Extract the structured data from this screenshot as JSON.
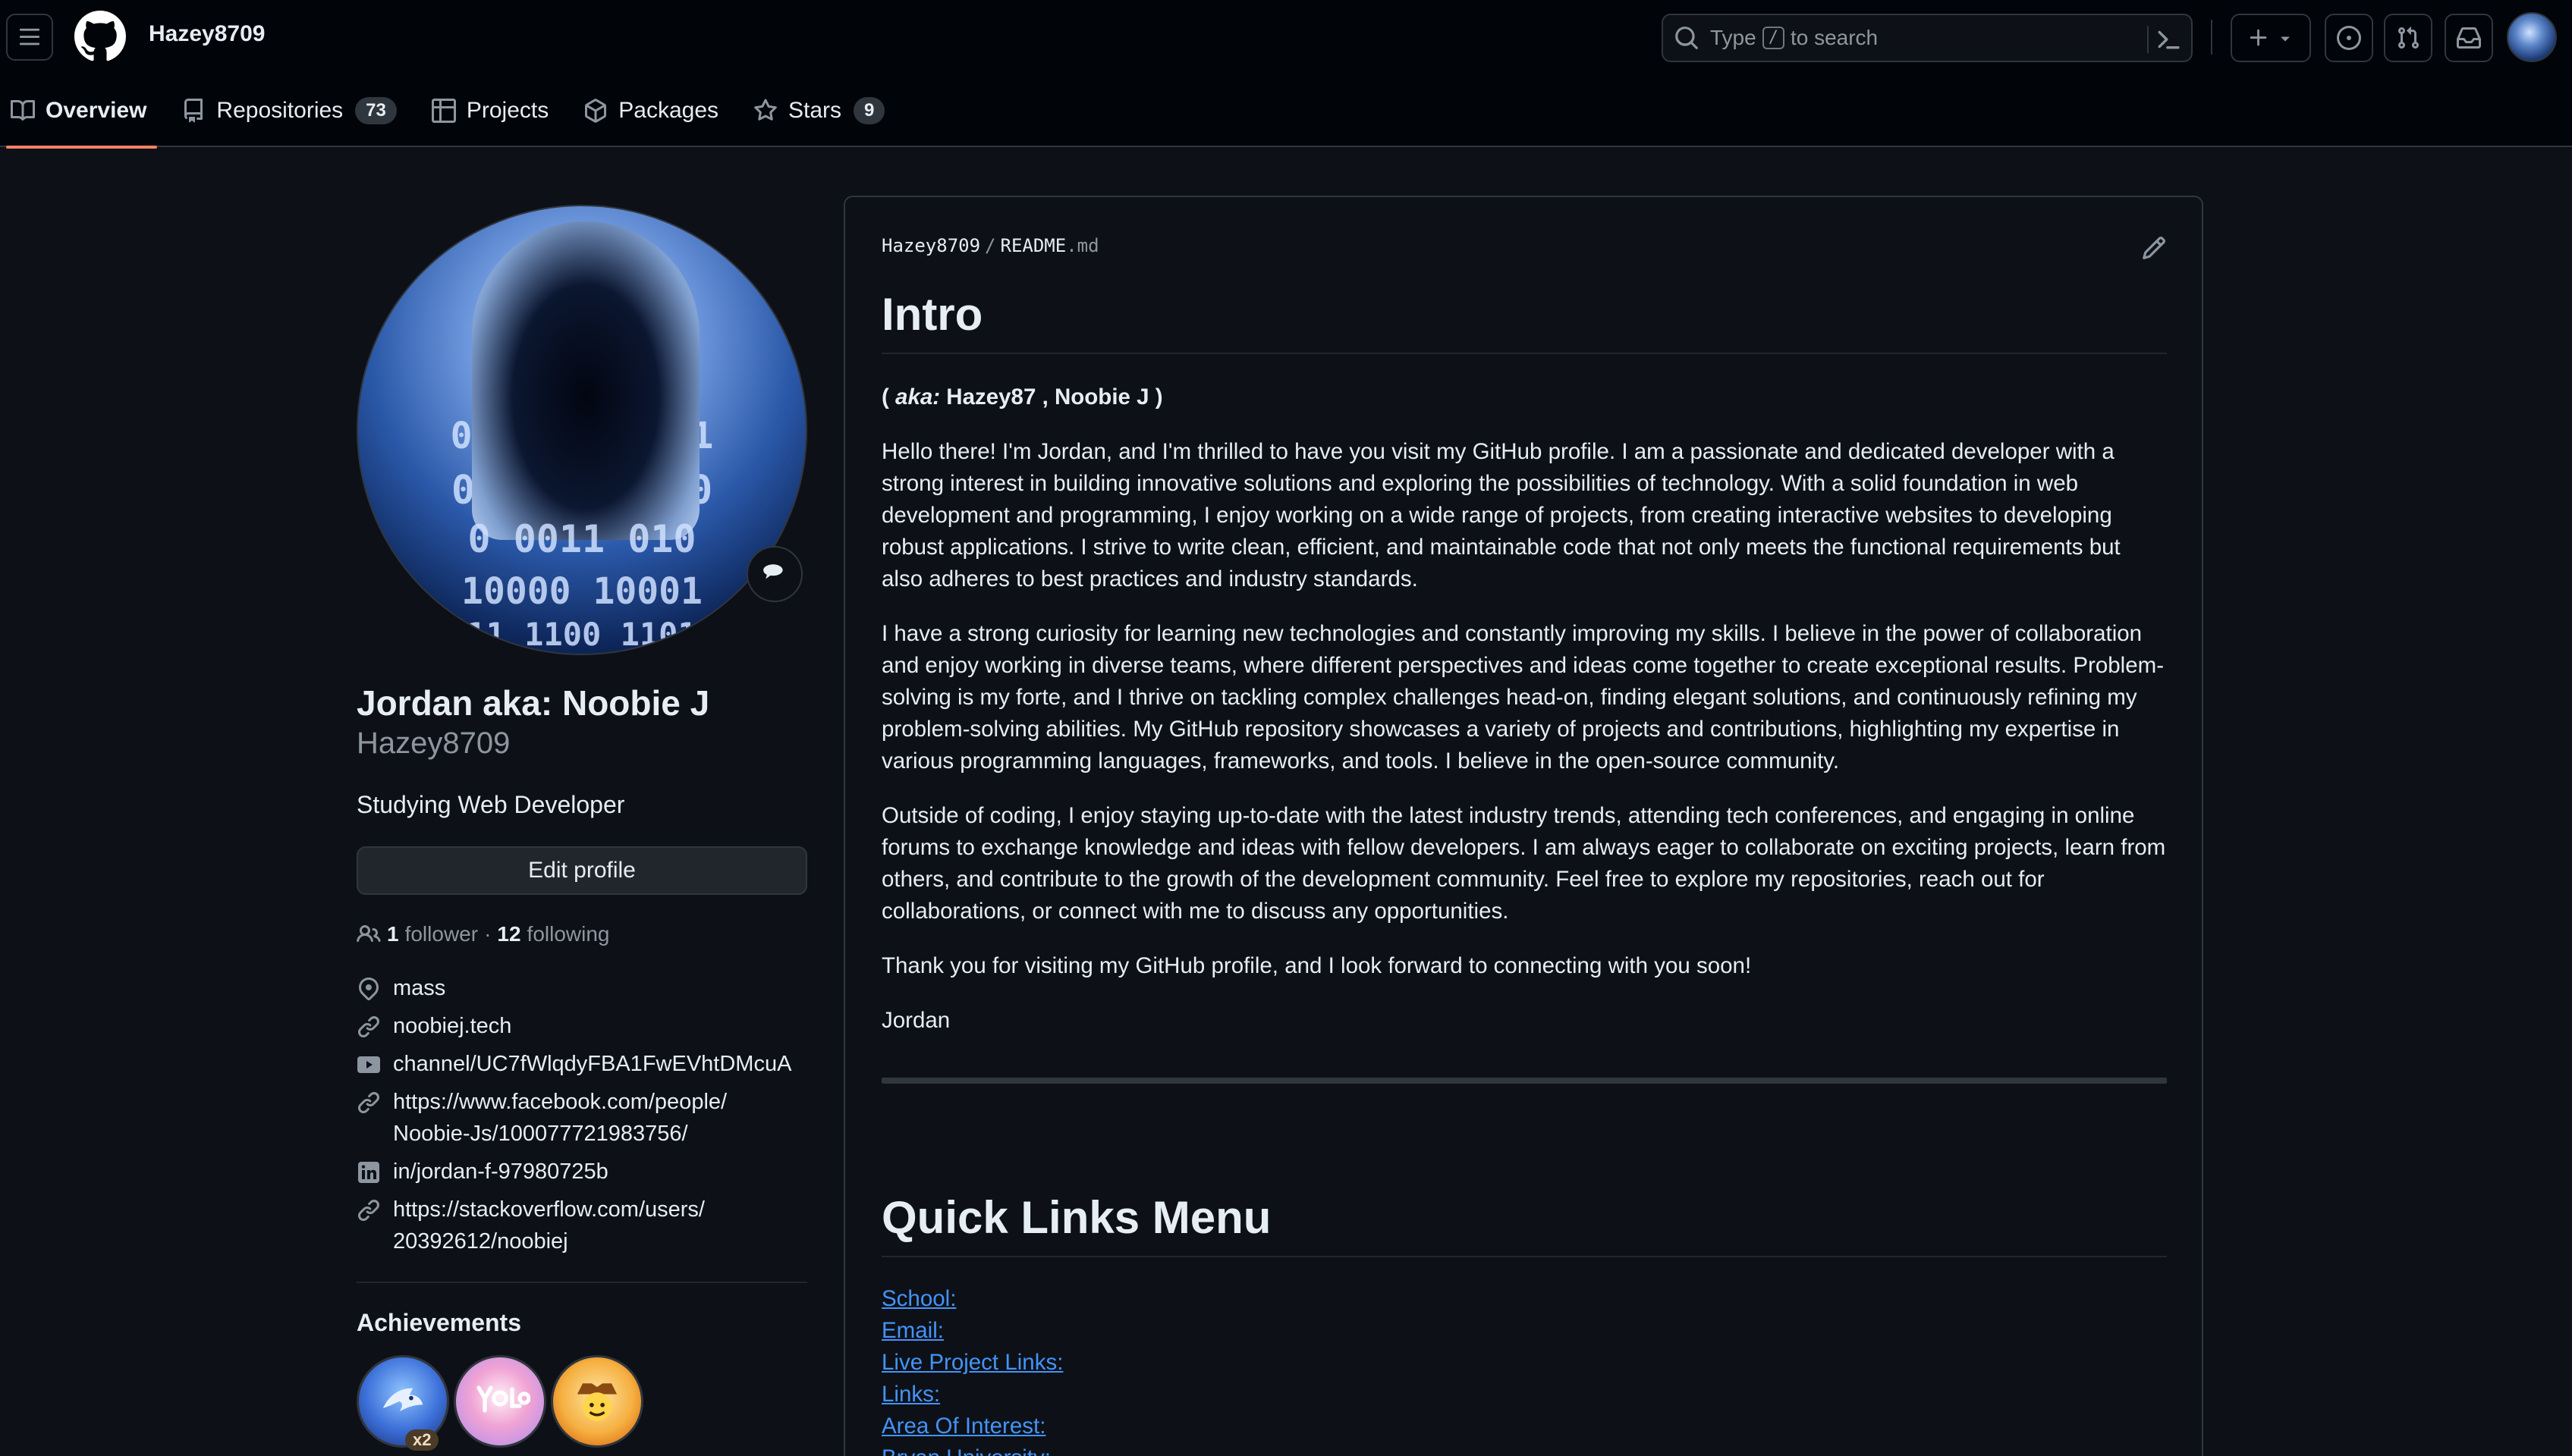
{
  "header": {
    "username": "Hazey8709",
    "search": {
      "prefix": "Type",
      "key": "/",
      "suffix": "to search"
    }
  },
  "tabs": [
    {
      "label": "Overview",
      "count": null,
      "active": true
    },
    {
      "label": "Repositories",
      "count": "73"
    },
    {
      "label": "Projects",
      "count": null
    },
    {
      "label": "Packages",
      "count": null
    },
    {
      "label": "Stars",
      "count": "9"
    }
  ],
  "profile": {
    "fullname": "Jordan aka: Noobie J",
    "login": "Hazey8709",
    "bio": "Studying Web Developer",
    "edit_label": "Edit profile",
    "followers": "1",
    "followers_label": "follower",
    "following": "12",
    "following_label": "following",
    "avatar_binary": [
      "0 10001",
      "0 1 0110 0 1",
      "0 1011 1100",
      "0 0011 010",
      "10000 10001",
      "11 1100 1101"
    ],
    "details": {
      "location": "mass",
      "website": "noobiej.tech",
      "youtube": "channel/UC7fWlqdyFBA1FwEVhtDMcuA",
      "facebook_1": "https://www.facebook.com/people/",
      "facebook_2": "Noobie-Js/100077721983756/",
      "linkedin": "in/jordan-f-97980725b",
      "stackoverflow_1": "https://stackoverflow.com/users/",
      "stackoverflow_2": "20392612/noobiej"
    },
    "achievements_title": "Achievements",
    "badge_count": "x2"
  },
  "readme": {
    "owner": "Hazey8709",
    "file": "README",
    "ext": ".md",
    "h1": "Intro",
    "aka_open": "(",
    "aka_label": "aka:",
    "aka_names": "Hazey87 , Noobie J",
    "aka_close": ")",
    "p1": "Hello there! I'm Jordan, and I'm thrilled to have you visit my GitHub profile. I am a passionate and dedicated developer with a strong interest in building innovative solutions and exploring the possibilities of technology. With a solid foundation in web development and programming, I enjoy working on a wide range of projects, from creating interactive websites to developing robust applications. I strive to write clean, efficient, and maintainable code that not only meets the functional requirements but also adheres to best practices and industry standards.",
    "p2": "I have a strong curiosity for learning new technologies and constantly improving my skills. I believe in the power of collaboration and enjoy working in diverse teams, where different perspectives and ideas come together to create exceptional results. Problem-solving is my forte, and I thrive on tackling complex challenges head-on, finding elegant solutions, and continuously refining my problem-solving abilities. My GitHub repository showcases a variety of projects and contributions, highlighting my expertise in various programming languages, frameworks, and tools. I believe in the open-source community.",
    "p3": "Outside of coding, I enjoy staying up-to-date with the latest industry trends, attending tech conferences, and engaging in online forums to exchange knowledge and ideas with fellow developers. I am always eager to collaborate on exciting projects, learn from others, and contribute to the growth of the development community. Feel free to explore my repositories, reach out for collaborations, or connect with me to discuss any opportunities.",
    "p4": "Thank you for visiting my GitHub profile, and I look forward to connecting with you soon!",
    "p5": "Jordan",
    "h2": "Quick Links Menu",
    "links": [
      "School:",
      "Email:",
      "Live Project Links:",
      "Links:",
      "Area Of Interest:",
      "Bryan University:"
    ]
  },
  "colors": {
    "bg": "#0d1117",
    "header_bg": "#010409",
    "border": "#30363d",
    "link": "#4493f8",
    "tab_underline": "#f78166",
    "muted": "#8d96a0"
  }
}
